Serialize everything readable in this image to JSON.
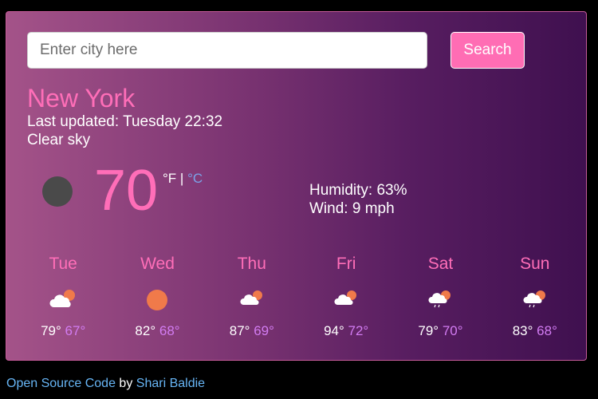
{
  "search": {
    "placeholder": "Enter city here",
    "value": "",
    "button_label": "Search"
  },
  "current": {
    "city": "New York",
    "last_updated": "Last updated: Tuesday 22:32",
    "description": "Clear sky",
    "icon": "moon-icon",
    "temperature": "70",
    "unit_f": "°F",
    "unit_sep": " | ",
    "unit_c": "°C",
    "humidity": "Humidity: 63%",
    "wind": "Wind: 9 mph"
  },
  "forecast": [
    {
      "day": "Tue",
      "icon": "partly-cloudy-icon",
      "max": "79°",
      "min": "67°"
    },
    {
      "day": "Wed",
      "icon": "sun-icon",
      "max": "82°",
      "min": "68°"
    },
    {
      "day": "Thu",
      "icon": "partly-cloudy-icon",
      "max": "87°",
      "min": "69°"
    },
    {
      "day": "Fri",
      "icon": "partly-cloudy-icon",
      "max": "94°",
      "min": "72°"
    },
    {
      "day": "Sat",
      "icon": "rain-cloud-icon",
      "max": "79°",
      "min": "70°"
    },
    {
      "day": "Sun",
      "icon": "rain-cloud-icon",
      "max": "83°",
      "min": "68°"
    }
  ],
  "footer": {
    "link_text": "Open Source Code",
    "by_text": " by ",
    "author": "Shari Baldie"
  },
  "colors": {
    "accent": "#ff6eb8",
    "min_temp": "#d27cf2",
    "link": "#67b5f5",
    "button": "#ff6db4"
  }
}
